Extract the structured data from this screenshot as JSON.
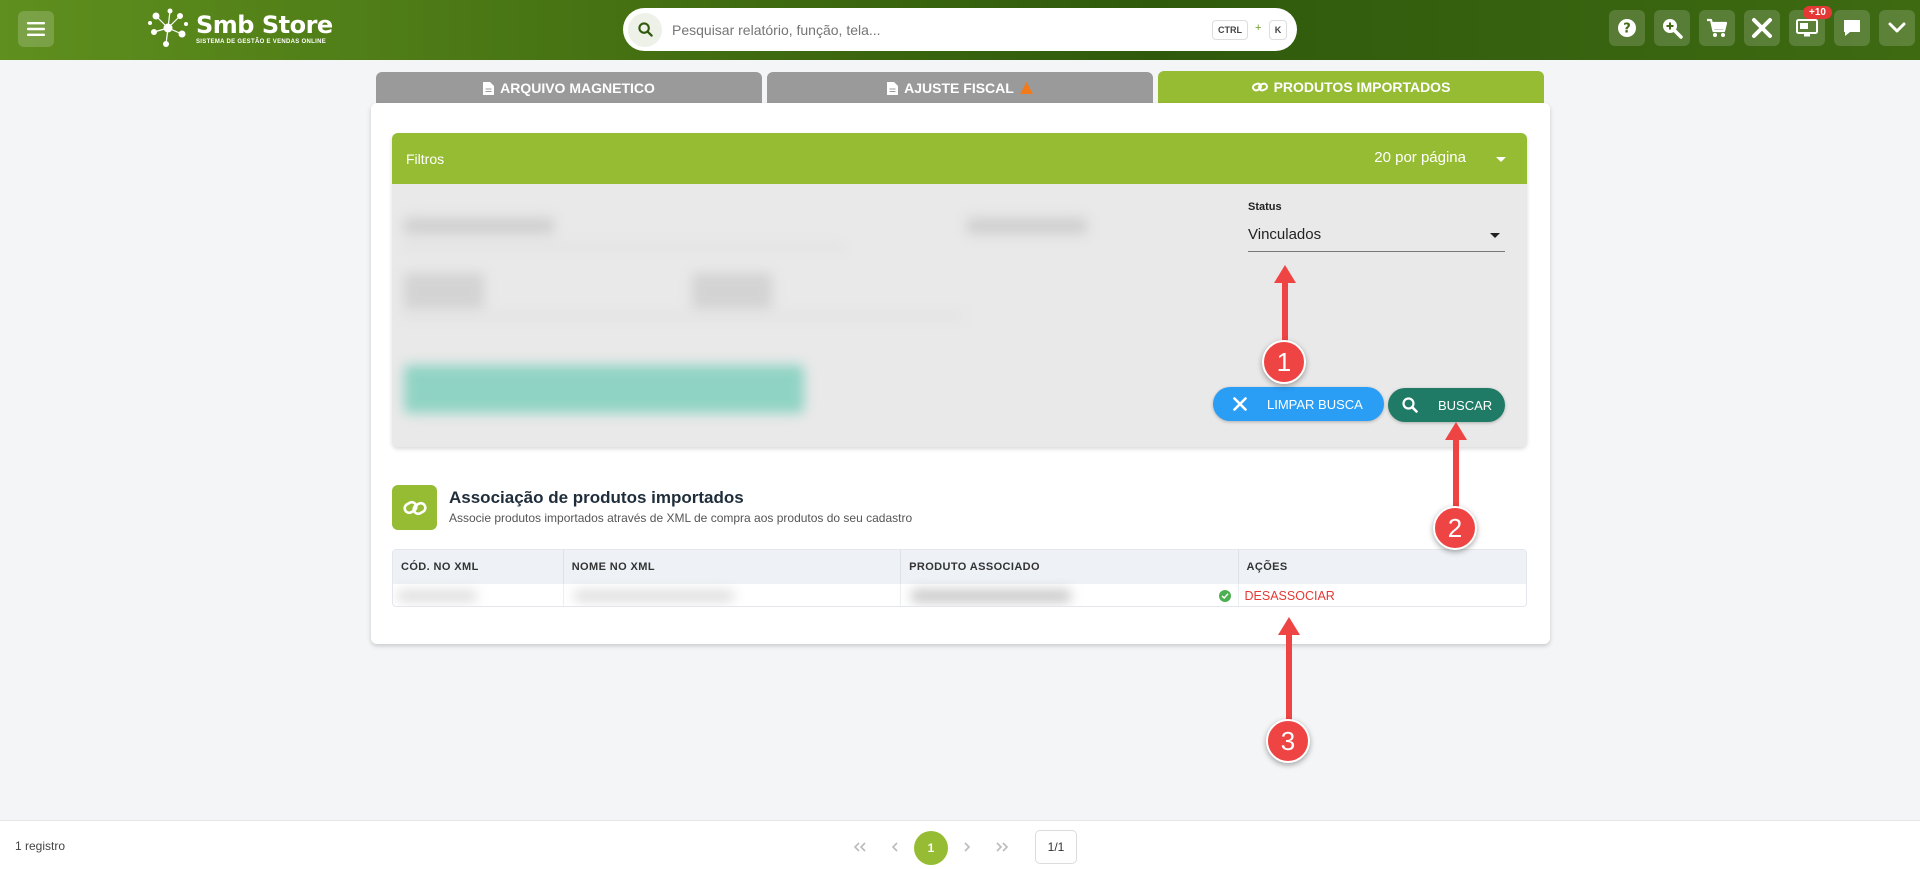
{
  "header": {
    "brand_name": "Smb Store",
    "brand_tagline": "SISTEMA DE GESTÃO E VENDAS ONLINE",
    "search_placeholder": "Pesquisar relatório, função, tela...",
    "shortcut_ctrl": "CTRL",
    "shortcut_plus": "+",
    "shortcut_key": "K",
    "notification_badge": "+10"
  },
  "tabs": [
    {
      "label": "ARQUIVO MAGNETICO",
      "icon": "document-icon"
    },
    {
      "label": "AJUSTE FISCAL",
      "icon": "document-icon",
      "warning": true
    },
    {
      "label": "PRODUTOS IMPORTADOS",
      "icon": "link-icon",
      "active": true
    }
  ],
  "filters": {
    "title": "Filtros",
    "per_page": "20 por página",
    "status_label": "Status",
    "status_value": "Vinculados",
    "clear_label": "LIMPAR BUSCA",
    "search_label": "BUSCAR"
  },
  "section": {
    "title": "Associação de produtos importados",
    "subtitle": "Associe produtos importados através de XML de compra aos produtos do seu cadastro"
  },
  "table": {
    "columns": [
      "CÓD. NO XML",
      "NOME NO XML",
      "PRODUTO ASSOCIADO",
      "AÇÕES"
    ],
    "rows": [
      {
        "action": "DESASSOCIAR",
        "linked": true
      }
    ]
  },
  "footer": {
    "records": "1 registro",
    "current_page": "1",
    "page_total": "1/1"
  },
  "annotations": [
    "1",
    "2",
    "3"
  ],
  "colors": {
    "brand_green": "#96bc33",
    "header_dark": "#3f6a10",
    "clear_button": "#2a9df4",
    "search_button": "#1f7a66",
    "danger": "#e53935",
    "annotation": "#ef4444"
  }
}
